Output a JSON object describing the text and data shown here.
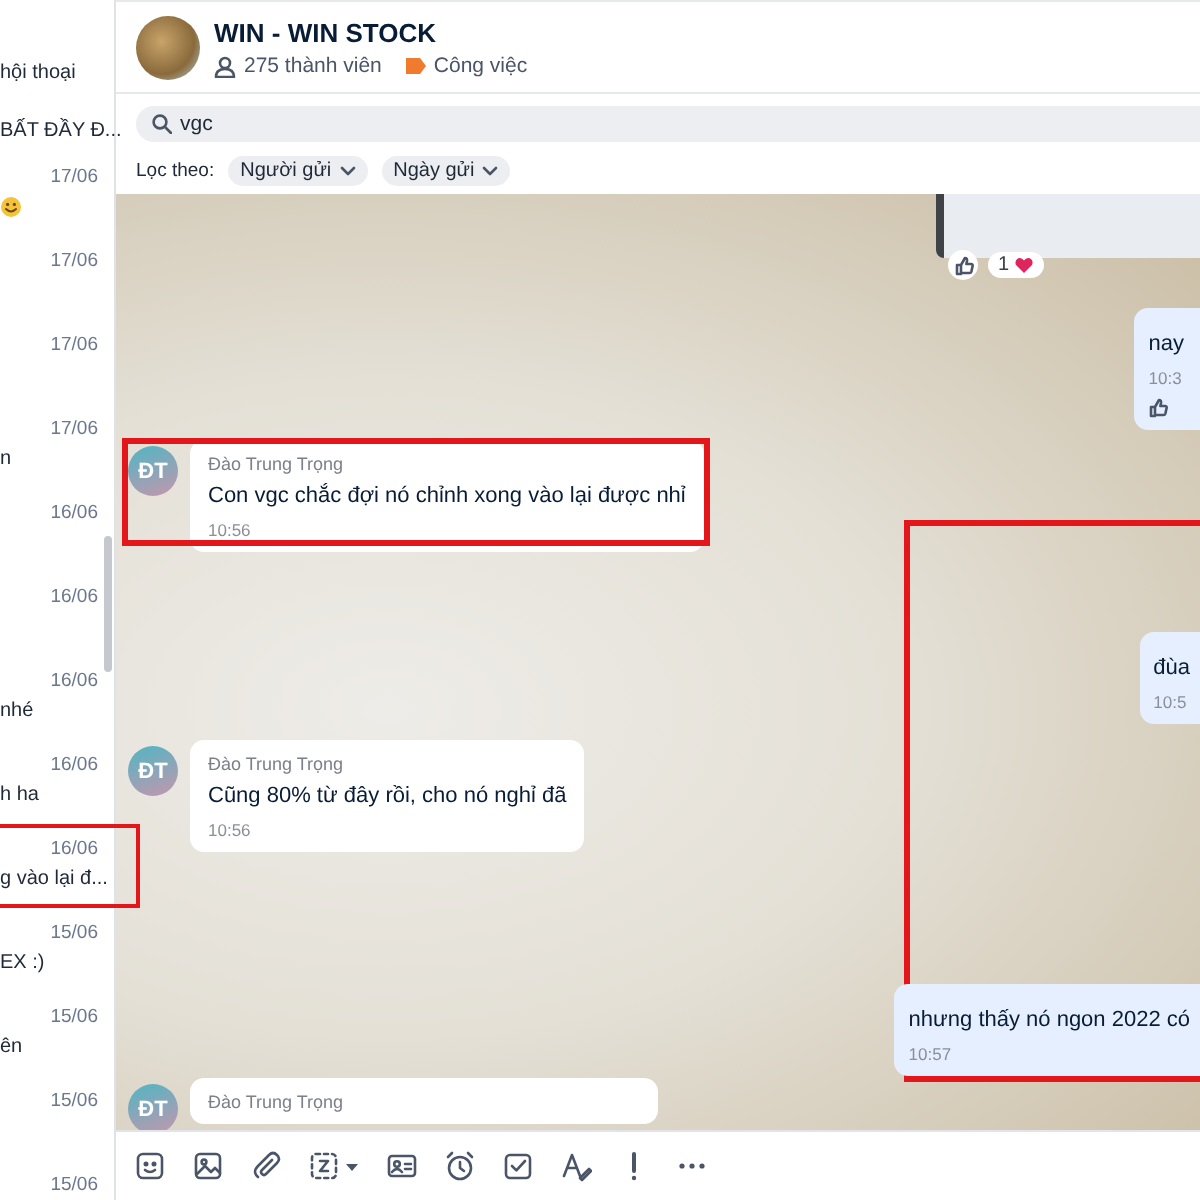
{
  "sidebar": {
    "conversations": [
      {
        "kind": "text",
        "preview": "hội thoại",
        "highlighted": false
      },
      {
        "kind": "text",
        "preview": "BẤT ĐẦY Đ...",
        "highlighted": false
      },
      {
        "kind": "emoji",
        "date": "17/06",
        "highlighted": false
      },
      {
        "kind": "text",
        "date": "17/06",
        "highlighted": false
      },
      {
        "kind": "text",
        "date": "17/06",
        "highlighted": false
      },
      {
        "kind": "text",
        "date": "17/06",
        "preview": "n",
        "highlighted": false
      },
      {
        "kind": "text",
        "date": "16/06",
        "highlighted": false
      },
      {
        "kind": "text",
        "date": "16/06",
        "highlighted": false
      },
      {
        "kind": "text",
        "date": "16/06",
        "preview": "nhé",
        "highlighted": false
      },
      {
        "kind": "text",
        "date": "16/06",
        "preview": "h ha",
        "highlighted": false
      },
      {
        "kind": "text",
        "date": "16/06",
        "preview": "g vào lại đ...",
        "highlighted": true
      },
      {
        "kind": "text",
        "date": "15/06",
        "preview": "EX :)",
        "highlighted": false
      },
      {
        "kind": "text",
        "date": "15/06",
        "preview": "ên",
        "highlighted": false
      },
      {
        "kind": "text",
        "date": "15/06",
        "highlighted": false
      },
      {
        "kind": "text",
        "date": "15/06",
        "highlighted": false
      }
    ]
  },
  "header": {
    "title": "WIN - WIN STOCK",
    "members": "275 thành viên",
    "tag": "Công việc"
  },
  "search": {
    "value": "vgc"
  },
  "filter": {
    "label": "Lọc theo:",
    "chips": [
      "Người gửi",
      "Ngày gửi"
    ]
  },
  "chat": {
    "incoming": [
      {
        "initials": "ĐT",
        "sender": "Đào Trung Trọng",
        "text": "Con vgc chắc đợi nó chỉnh xong vào lại được nhỉ",
        "time": "10:56",
        "highlighted": true
      },
      {
        "initials": "ĐT",
        "sender": "Đào Trung Trọng",
        "text": "Cũng 80% từ đây rồi, cho nó nghỉ đã",
        "time": "10:56",
        "highlighted": false
      },
      {
        "initials": "ĐT",
        "sender": "Đào Trung Trọng",
        "highlighted": false
      }
    ],
    "outgoing": [
      {
        "kind": "image",
        "reaction_count": "1"
      },
      {
        "kind": "text",
        "text": "nay",
        "time": "10:3"
      },
      {
        "kind": "group",
        "highlighted": true,
        "messages": [
          {
            "text": "đùa",
            "time": "10:5"
          },
          {
            "text": "nhưng thấy nó ngon 2022 có",
            "time": "10:57"
          }
        ]
      }
    ]
  },
  "toolbar": {
    "tools": [
      {
        "kind": "sticker"
      },
      {
        "kind": "image"
      },
      {
        "kind": "attachment"
      },
      {
        "kind": "screenshot"
      },
      {
        "kind": "contact"
      },
      {
        "kind": "reminder"
      },
      {
        "kind": "task"
      },
      {
        "kind": "format"
      },
      {
        "kind": "urgent"
      },
      {
        "kind": "more"
      }
    ]
  }
}
